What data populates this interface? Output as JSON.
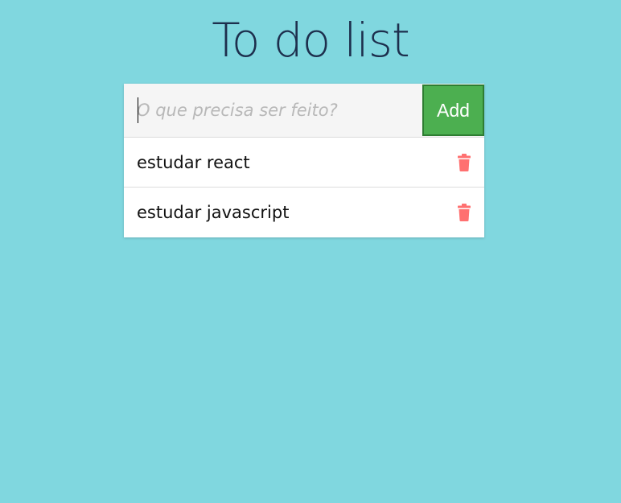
{
  "app": {
    "title": "To do list"
  },
  "input": {
    "placeholder": "O que precisa ser feito?",
    "value": ""
  },
  "add_button": {
    "label": "Add"
  },
  "todos": [
    {
      "text": "estudar react",
      "icon": "trash-icon"
    },
    {
      "text": "estudar javascript",
      "icon": "trash-icon"
    }
  ],
  "colors": {
    "background": "#80d7df",
    "title": "#1d2f4d",
    "add_button": "#4caf50",
    "trash": "#ff7070"
  }
}
